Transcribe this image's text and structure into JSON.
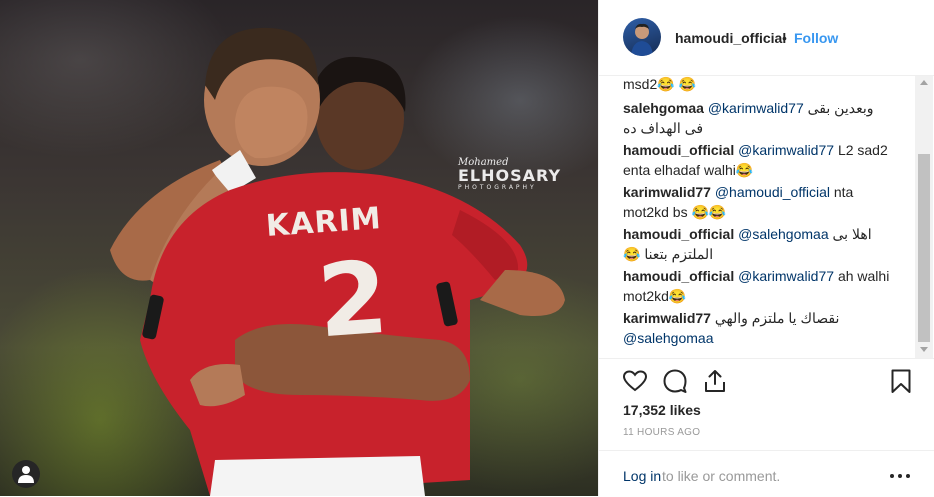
{
  "photo": {
    "watermark_script": "Mohamed",
    "watermark_main": "ELHOSARY",
    "watermark_sub": "PHOTOGRAPHY",
    "shirt_name": "KARIM",
    "shirt_number": "2",
    "user_tag_icon": "user-tag-icon"
  },
  "header": {
    "username": "hamoudi_official",
    "separator": "•",
    "follow_label": "Follow",
    "avatar_icon": "profile-avatar"
  },
  "comments": [
    {
      "user": "",
      "mention": "",
      "text": "msd2😂 😂"
    },
    {
      "user": "salehgomaa",
      "mention": "@karimwalid77",
      "text": "وبعدين بقى",
      "text2": "فى الهداف ده"
    },
    {
      "user": "hamoudi_official",
      "mention": "@karimwalid77",
      "text": "L2 sad2",
      "text2": "enta elhadaf walhi😂"
    },
    {
      "user": "karimwalid77",
      "mention": "@hamoudi_official",
      "text": "nta",
      "text2": "mot2kd bs 😂😂"
    },
    {
      "user": "hamoudi_official",
      "mention": "@salehgomaa",
      "text": "اهلا بى",
      "text2": "الملتزم بتعنا 😂"
    },
    {
      "user": "hamoudi_official",
      "mention": "@karimwalid77",
      "text": "ah walhi",
      "text2": "mot2kd😂"
    },
    {
      "user": "karimwalid77",
      "mention": "",
      "text": "نقصاك يا ملتزم والهي",
      "mention2": "@salehgomaa"
    }
  ],
  "actions": {
    "like_icon": "heart-icon",
    "comment_icon": "comment-icon",
    "share_icon": "share-icon",
    "save_icon": "bookmark-icon"
  },
  "likes": "17,352 likes",
  "time_ago": "11 HOURS AGO",
  "footer": {
    "login_label": "Log in",
    "login_rest": "to like or comment.",
    "more_icon": "more-options-icon"
  },
  "colors": {
    "link_blue": "#3897f0",
    "mention_blue": "#003569",
    "text": "#262626",
    "muted": "#999999",
    "jersey_red": "#c8222c"
  }
}
